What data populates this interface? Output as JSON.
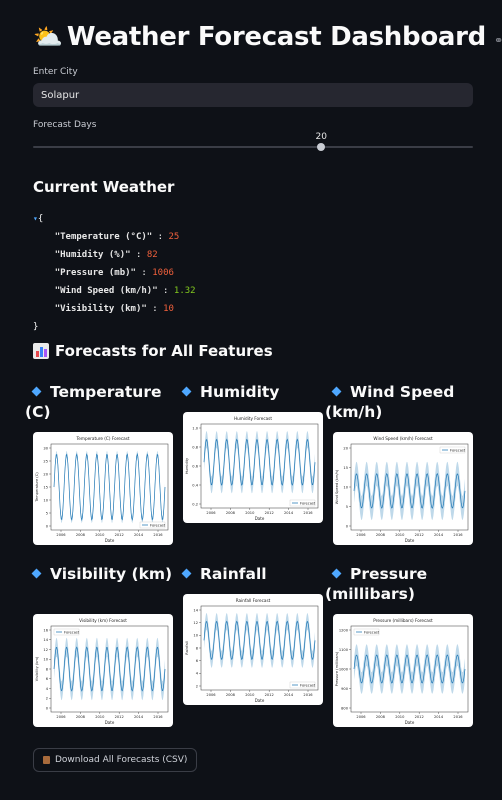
{
  "header": {
    "emoji": "⛅",
    "title": "Weather Forecast Dashboard",
    "link_icon": "link-icon"
  },
  "city": {
    "label": "Enter City",
    "value": "Solapur"
  },
  "days": {
    "label": "Forecast Days",
    "value": 20,
    "min": 1,
    "max": 30,
    "value_text": "20"
  },
  "current": {
    "heading": "Current Weather",
    "open": "{",
    "close": "}",
    "entries": [
      {
        "key": "\"Temperature (°C)\"",
        "value": "25",
        "kind": "num"
      },
      {
        "key": "\"Humidity (%)\"",
        "value": "82",
        "kind": "num"
      },
      {
        "key": "\"Pressure (mb)\"",
        "value": "1006",
        "kind": "num"
      },
      {
        "key": "\"Wind Speed (km/h)\"",
        "value": "1.32",
        "kind": "flt"
      },
      {
        "key": "\"Visibility (km)\"",
        "value": "10",
        "kind": "num"
      }
    ]
  },
  "forecasts": {
    "heading": "Forecasts for All Features",
    "cards": [
      {
        "label": "Temperature (C)",
        "plot_title": "Temperature (C) Forecast",
        "ylabel": "Temperature (C)",
        "legend": "Forecast",
        "legend_pos": "bottom-right",
        "yticks": [
          "0",
          "5",
          "10",
          "15",
          "20",
          "25",
          "30"
        ],
        "xticks": [
          "2006",
          "2008",
          "2010",
          "2012",
          "2014",
          "2016"
        ],
        "xlabel": "Date"
      },
      {
        "label": "Humidity",
        "plot_title": "Humidity Forecast",
        "ylabel": "Humidity",
        "legend": "Forecast",
        "legend_pos": "bottom-right",
        "yticks": [
          "0.2",
          "0.4",
          "0.6",
          "0.8",
          "1.0"
        ],
        "xticks": [
          "2006",
          "2008",
          "2010",
          "2012",
          "2014",
          "2016"
        ],
        "xlabel": "Date"
      },
      {
        "label": "Wind Speed (km/h)",
        "plot_title": "Wind Speed (km/h) Forecast",
        "ylabel": "Wind Speed (km/h)",
        "legend": "Forecast",
        "legend_pos": "top-right",
        "yticks": [
          "0",
          "5",
          "10",
          "15",
          "20"
        ],
        "xticks": [
          "2006",
          "2008",
          "2010",
          "2012",
          "2014",
          "2016"
        ],
        "xlabel": "Date"
      },
      {
        "label": "Visibility (km)",
        "plot_title": "Visibility (km) Forecast",
        "ylabel": "Visibility (km)",
        "legend": "Forecast",
        "legend_pos": "top-left",
        "yticks": [
          "0",
          "2",
          "4",
          "6",
          "8",
          "10",
          "12",
          "14",
          "16"
        ],
        "xticks": [
          "2006",
          "2008",
          "2010",
          "2012",
          "2014",
          "2016"
        ],
        "xlabel": "Date"
      },
      {
        "label": "Rainfall",
        "plot_title": "Rainfall Forecast",
        "ylabel": "Rainfall",
        "legend": "Forecast",
        "legend_pos": "bottom-right",
        "yticks": [
          "2",
          "4",
          "6",
          "8",
          "10",
          "12",
          "14"
        ],
        "xticks": [
          "2006",
          "2008",
          "2010",
          "2012",
          "2014",
          "2016"
        ],
        "xlabel": "Date"
      },
      {
        "label": "Pressure (millibars)",
        "plot_title": "Pressure (millibars) Forecast",
        "ylabel": "Pressure (millibars)",
        "legend": "Forecast",
        "legend_pos": "top-left",
        "yticks": [
          "800",
          "900",
          "1000",
          "1100",
          "1200"
        ],
        "xticks": [
          "2006",
          "2008",
          "2010",
          "2012",
          "2014",
          "2016"
        ],
        "xlabel": "Date"
      }
    ]
  },
  "download": {
    "icon": "clipboard-icon",
    "label": "Download All Forecasts (CSV)"
  },
  "colors": {
    "bg": "#0e1117",
    "input_bg": "#262730",
    "accent": "#4fa8ff",
    "line": "#1f77b4",
    "band": "#a9cce3"
  }
}
